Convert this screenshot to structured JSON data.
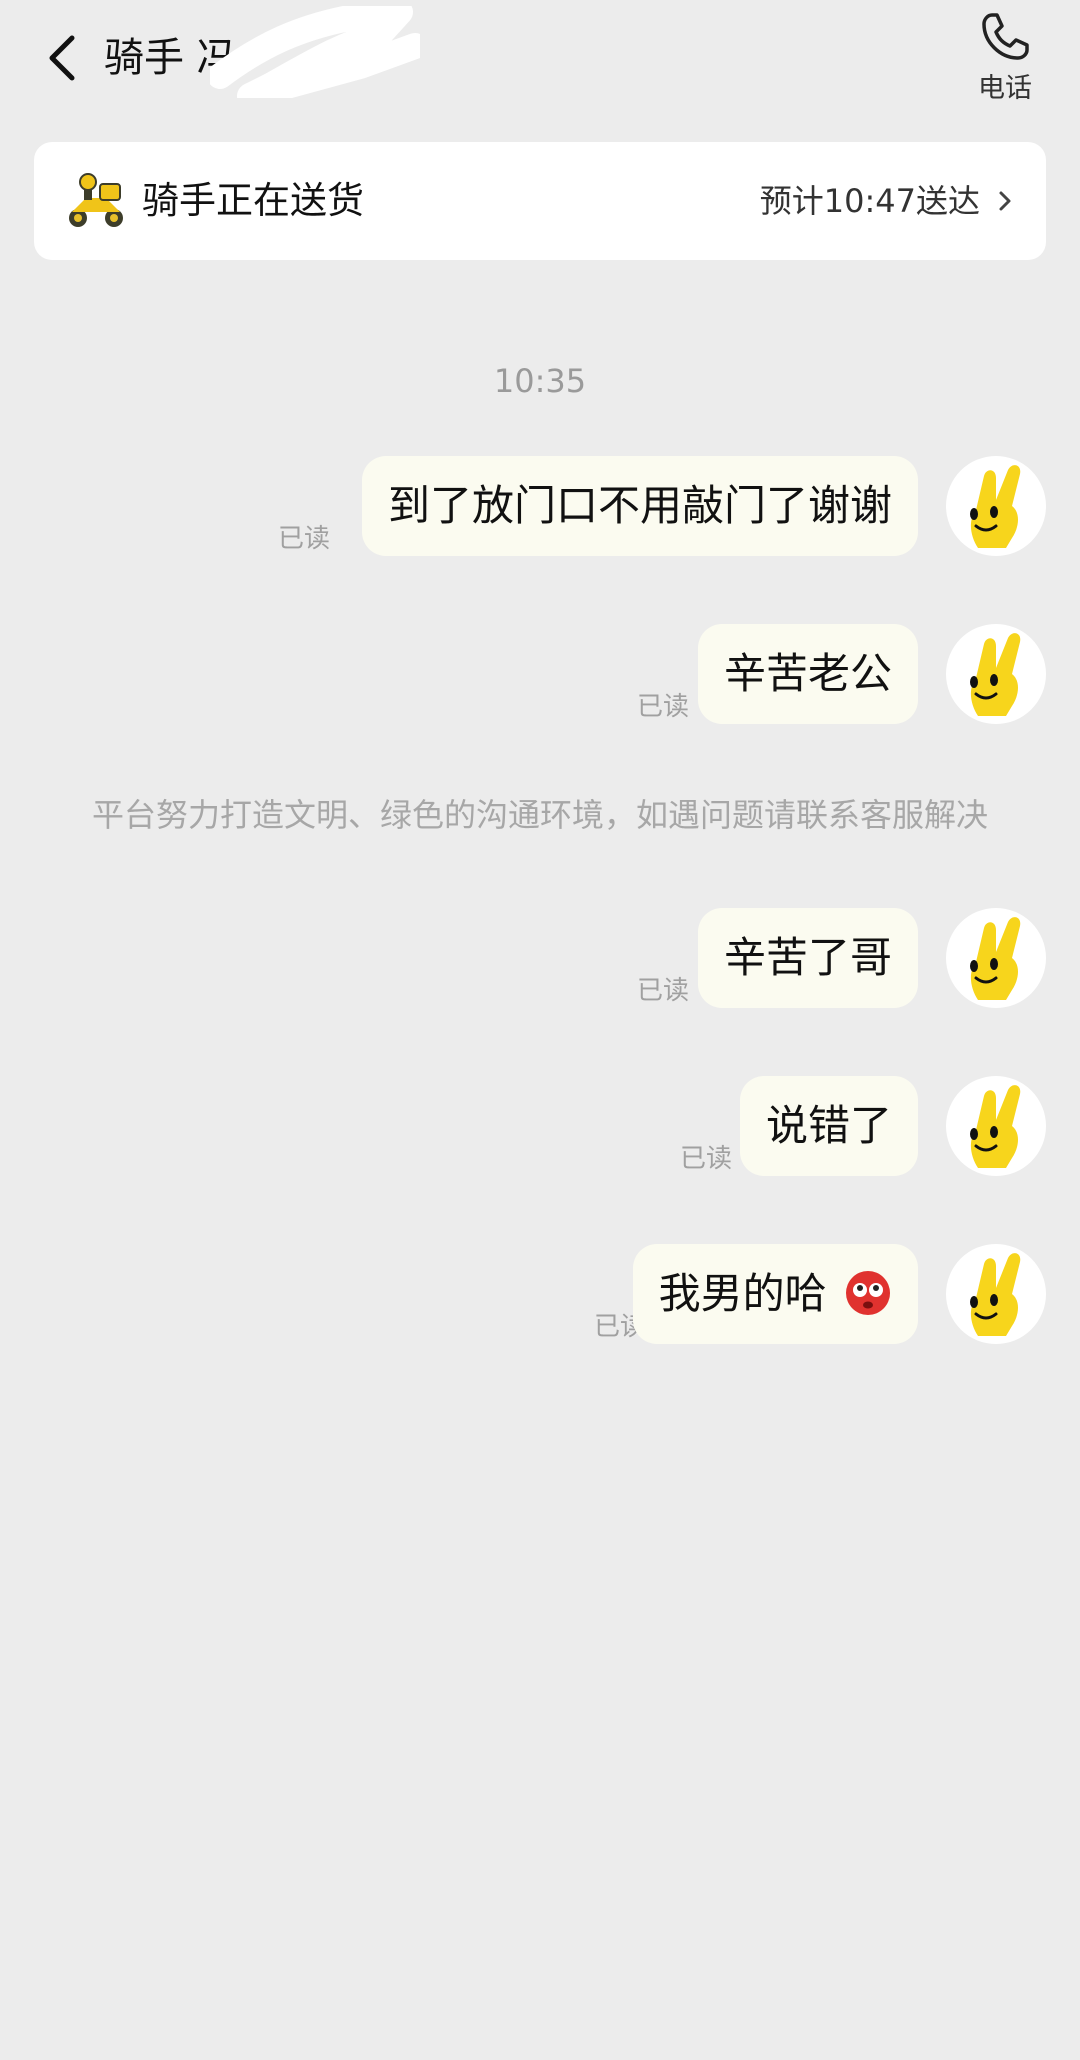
{
  "header": {
    "title": "骑手 冯",
    "call_label": "电话"
  },
  "status_card": {
    "status": "骑手正在送货",
    "eta": "预计10:47送达"
  },
  "chat": {
    "time": "10:35",
    "notice": "平台努力打造文明、绿色的沟通环境，如遇问题请联系客服解决",
    "messages": [
      {
        "text": "到了放门口不用敲门了谢谢",
        "read": "已读"
      },
      {
        "text": "辛苦老公",
        "read": "已读"
      },
      {
        "text": "辛苦了哥",
        "read": "已读"
      },
      {
        "text": "说错了",
        "read": "已读"
      },
      {
        "text": "我男的哈",
        "read": "已读"
      }
    ]
  },
  "colors": {
    "background": "#ececec",
    "bubble": "#fbfbf0",
    "avatar_yellow": "#f7d51c"
  },
  "icons": {
    "back": "chevron-left-icon",
    "call": "phone-icon",
    "scooter": "delivery-scooter-icon",
    "eta_arrow": "chevron-right-icon",
    "emoji": "flushed-face-emoji"
  }
}
